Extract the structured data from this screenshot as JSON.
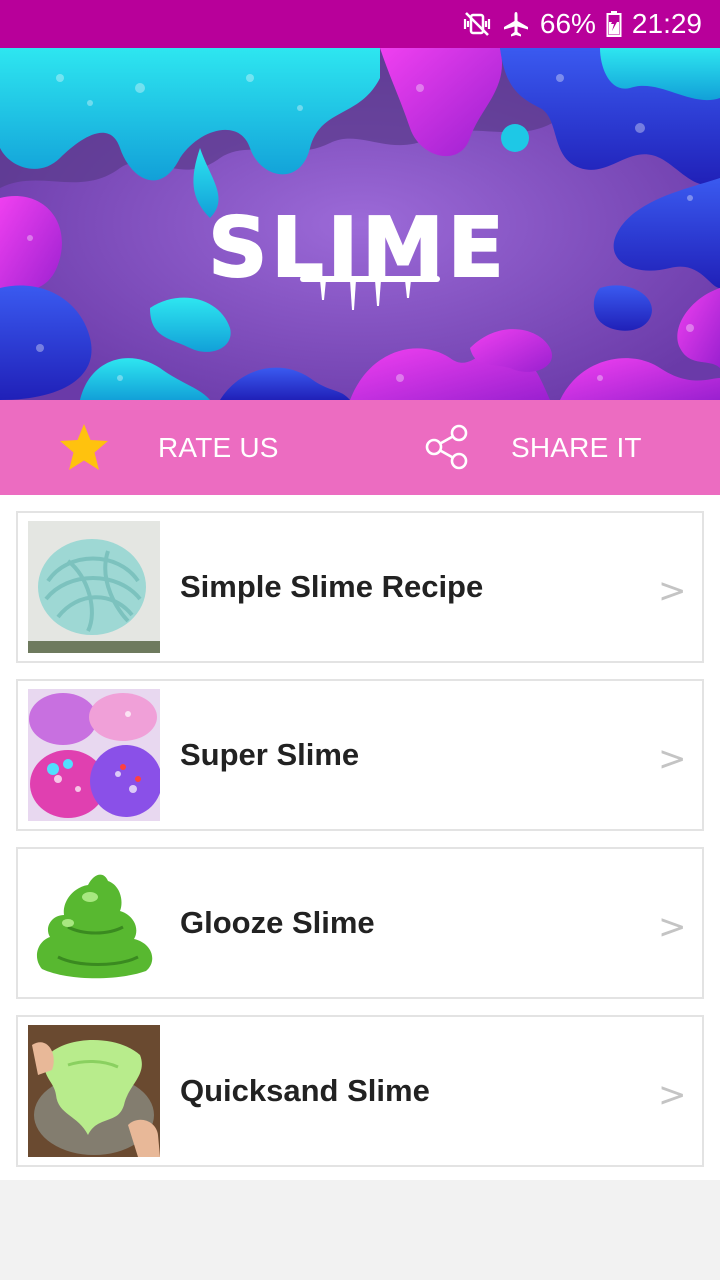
{
  "status_bar": {
    "battery": "66%",
    "time": "21:29",
    "icons": [
      "vibrate-mute-icon",
      "airplane-icon",
      "battery-icon"
    ]
  },
  "banner": {
    "title": "SLIME",
    "colors": {
      "bg": "#8a5ac8",
      "cyan": "#1ec8e6",
      "blue": "#2a3ad8",
      "magenta": "#c02ad8",
      "dark": "#5a3a8a"
    }
  },
  "actions": {
    "rate_label": "RATE US",
    "share_label": "SHARE IT",
    "bar_color": "#ec6cc1",
    "star_color": "#ffc20e"
  },
  "recipes": [
    {
      "title": "Simple Slime Recipe",
      "chevron": ">"
    },
    {
      "title": "Super Slime",
      "chevron": ">"
    },
    {
      "title": "Glooze Slime",
      "chevron": ">"
    },
    {
      "title": "Quicksand Slime",
      "chevron": ">"
    }
  ]
}
